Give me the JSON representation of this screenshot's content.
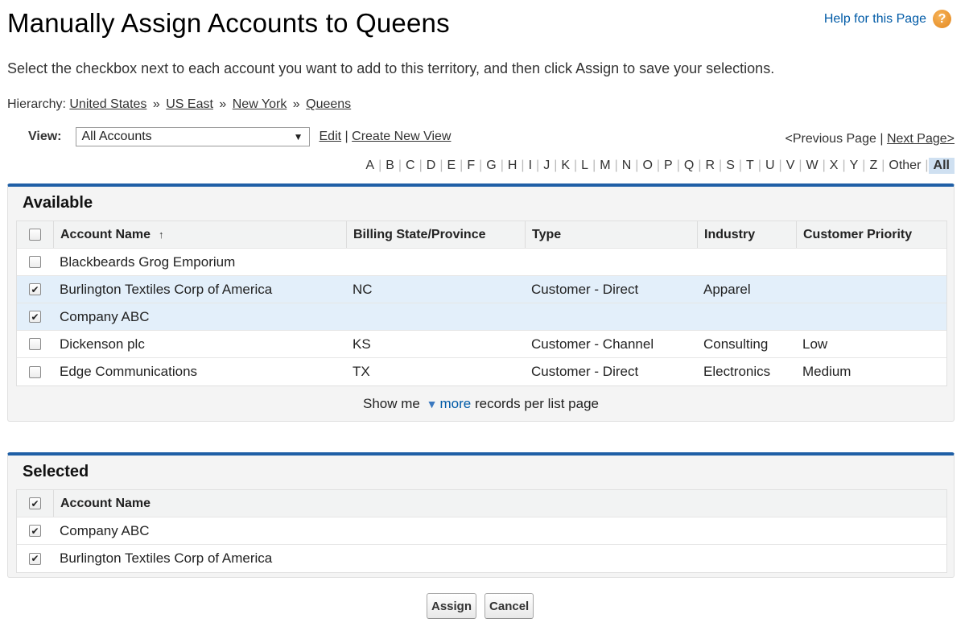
{
  "page": {
    "title": "Manually Assign Accounts to Queens",
    "help_label": "Help for this Page",
    "help_icon": "?",
    "instructions": "Select the checkbox next to each account you want to add to this territory, and then click Assign to save your selections."
  },
  "hierarchy": {
    "label": "Hierarchy:",
    "separator": "»",
    "items": [
      "United States",
      "US East",
      "New York",
      "Queens"
    ]
  },
  "view": {
    "label": "View:",
    "selected": "All Accounts",
    "edit_label": "Edit",
    "divider": "|",
    "create_label": "Create New View"
  },
  "pager": {
    "previous_label": "<Previous Page",
    "divider": "|",
    "next_label": "Next Page>"
  },
  "alpha": {
    "letters": [
      "A",
      "B",
      "C",
      "D",
      "E",
      "F",
      "G",
      "H",
      "I",
      "J",
      "K",
      "L",
      "M",
      "N",
      "O",
      "P",
      "Q",
      "R",
      "S",
      "T",
      "U",
      "V",
      "W",
      "X",
      "Y",
      "Z",
      "Other",
      "All"
    ],
    "active": "All"
  },
  "available": {
    "title": "Available",
    "columns": [
      "Account Name",
      "Billing State/Province",
      "Type",
      "Industry",
      "Customer Priority"
    ],
    "sort_icon": "↑",
    "rows": [
      {
        "checked": false,
        "name": "Blackbeards Grog Emporium",
        "state": "",
        "type": "",
        "industry": "",
        "priority": ""
      },
      {
        "checked": true,
        "name": "Burlington Textiles Corp of America",
        "state": "NC",
        "type": "Customer - Direct",
        "industry": "Apparel",
        "priority": ""
      },
      {
        "checked": true,
        "name": "Company ABC",
        "state": "",
        "type": "",
        "industry": "",
        "priority": ""
      },
      {
        "checked": false,
        "name": "Dickenson plc",
        "state": "KS",
        "type": "Customer - Channel",
        "industry": "Consulting",
        "priority": "Low"
      },
      {
        "checked": false,
        "name": "Edge Communications",
        "state": "TX",
        "type": "Customer - Direct",
        "industry": "Electronics",
        "priority": "Medium"
      }
    ],
    "show_more": {
      "prefix": "Show me",
      "link": "more",
      "suffix": "records per list page"
    }
  },
  "selected": {
    "title": "Selected",
    "column": "Account Name",
    "rows": [
      {
        "checked": true,
        "name": "Company ABC"
      },
      {
        "checked": true,
        "name": "Burlington Textiles Corp of America"
      }
    ]
  },
  "buttons": {
    "assign": "Assign",
    "cancel": "Cancel"
  },
  "colors": {
    "panel_accent": "#1f5fa6",
    "link": "#015ba7",
    "row_highlight": "#e3effa"
  }
}
